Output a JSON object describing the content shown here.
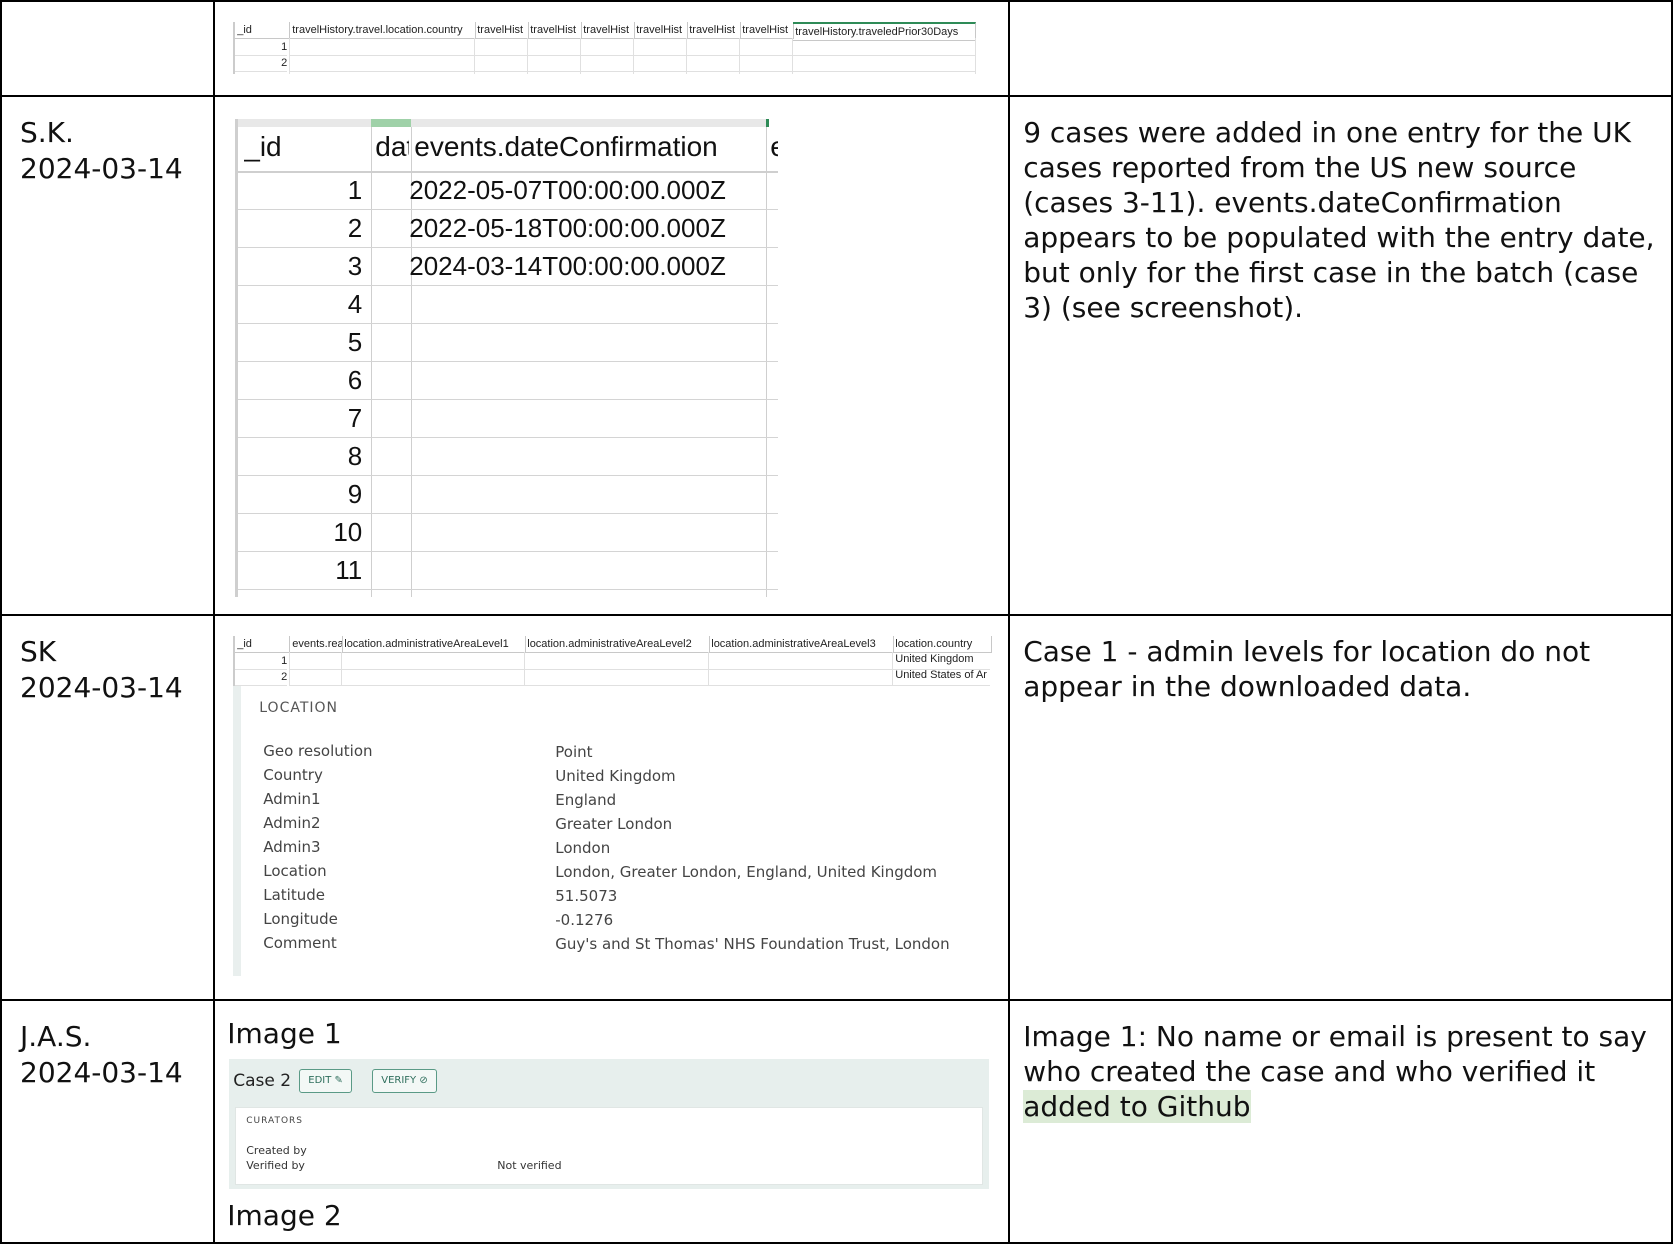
{
  "rows": [
    {
      "who": "",
      "note": "",
      "sheet": {
        "headers": [
          "_id",
          "travelHistory.travel.location.country",
          "travelHist",
          "travelHist",
          "travelHist",
          "travelHist",
          "travelHist",
          "travelHist",
          "travelHistory.traveledPrior30Days"
        ],
        "ids": [
          "1",
          "2"
        ]
      }
    },
    {
      "who": "S.K.\n2024-03-14",
      "note": "9 cases were added in one entry for the UK cases reported from the US new source (cases 3-11). events.dateConfirmation appears to be populated with the entry date, but only for the first case in the batch (case 3) (see screenshot).",
      "sheet": {
        "headers": [
          "_id",
          "dat",
          "events.dateConfirmation",
          "e"
        ],
        "rows": [
          {
            "id": "1",
            "value": "2022-05-07T00:00:00.000Z"
          },
          {
            "id": "2",
            "value": "2022-05-18T00:00:00.000Z"
          },
          {
            "id": "3",
            "value": "2024-03-14T00:00:00.000Z"
          },
          {
            "id": "4",
            "value": ""
          },
          {
            "id": "5",
            "value": ""
          },
          {
            "id": "6",
            "value": ""
          },
          {
            "id": "7",
            "value": ""
          },
          {
            "id": "8",
            "value": ""
          },
          {
            "id": "9",
            "value": ""
          },
          {
            "id": "10",
            "value": ""
          },
          {
            "id": "11",
            "value": ""
          }
        ]
      }
    },
    {
      "who": "SK\n2024-03-14",
      "note": "Case 1 - admin levels for location do not appear in the downloaded data.",
      "sheet": {
        "headers": [
          "_id",
          "events.rea",
          "location.administrativeAreaLevel1",
          "location.administrativeAreaLevel2",
          "location.administrativeAreaLevel3",
          "location.country"
        ],
        "rows": [
          {
            "id": "1",
            "country": "United Kingdom"
          },
          {
            "id": "2",
            "country": "United States of Ar"
          }
        ]
      },
      "location": {
        "title": "LOCATION",
        "fields": [
          {
            "label": "Geo resolution",
            "value": "Point"
          },
          {
            "label": "Country",
            "value": "United Kingdom"
          },
          {
            "label": "Admin1",
            "value": "England"
          },
          {
            "label": "Admin2",
            "value": "Greater London"
          },
          {
            "label": "Admin3",
            "value": "London"
          },
          {
            "label": "Location",
            "value": "London, Greater London, England, United Kingdom"
          },
          {
            "label": "Latitude",
            "value": "51.5073"
          },
          {
            "label": "Longitude",
            "value": "-0.1276"
          },
          {
            "label": "Comment",
            "value": "Guy's and St Thomas' NHS Foundation Trust, London"
          }
        ]
      }
    },
    {
      "who": "J.A.S.\n2024-03-14",
      "note": "Image 1: No name or email is present to say who created the case and who verified it",
      "highlight": "added to Github",
      "image1_caption": "Image 1",
      "image2_caption": "Image 2",
      "case": {
        "title": "Case 2",
        "edit_label": "EDIT",
        "verify_label": "VERIFY",
        "section": "CURATORS",
        "created_label": "Created by",
        "verified_label": "Verified by",
        "verified_value": "Not verified"
      }
    }
  ]
}
